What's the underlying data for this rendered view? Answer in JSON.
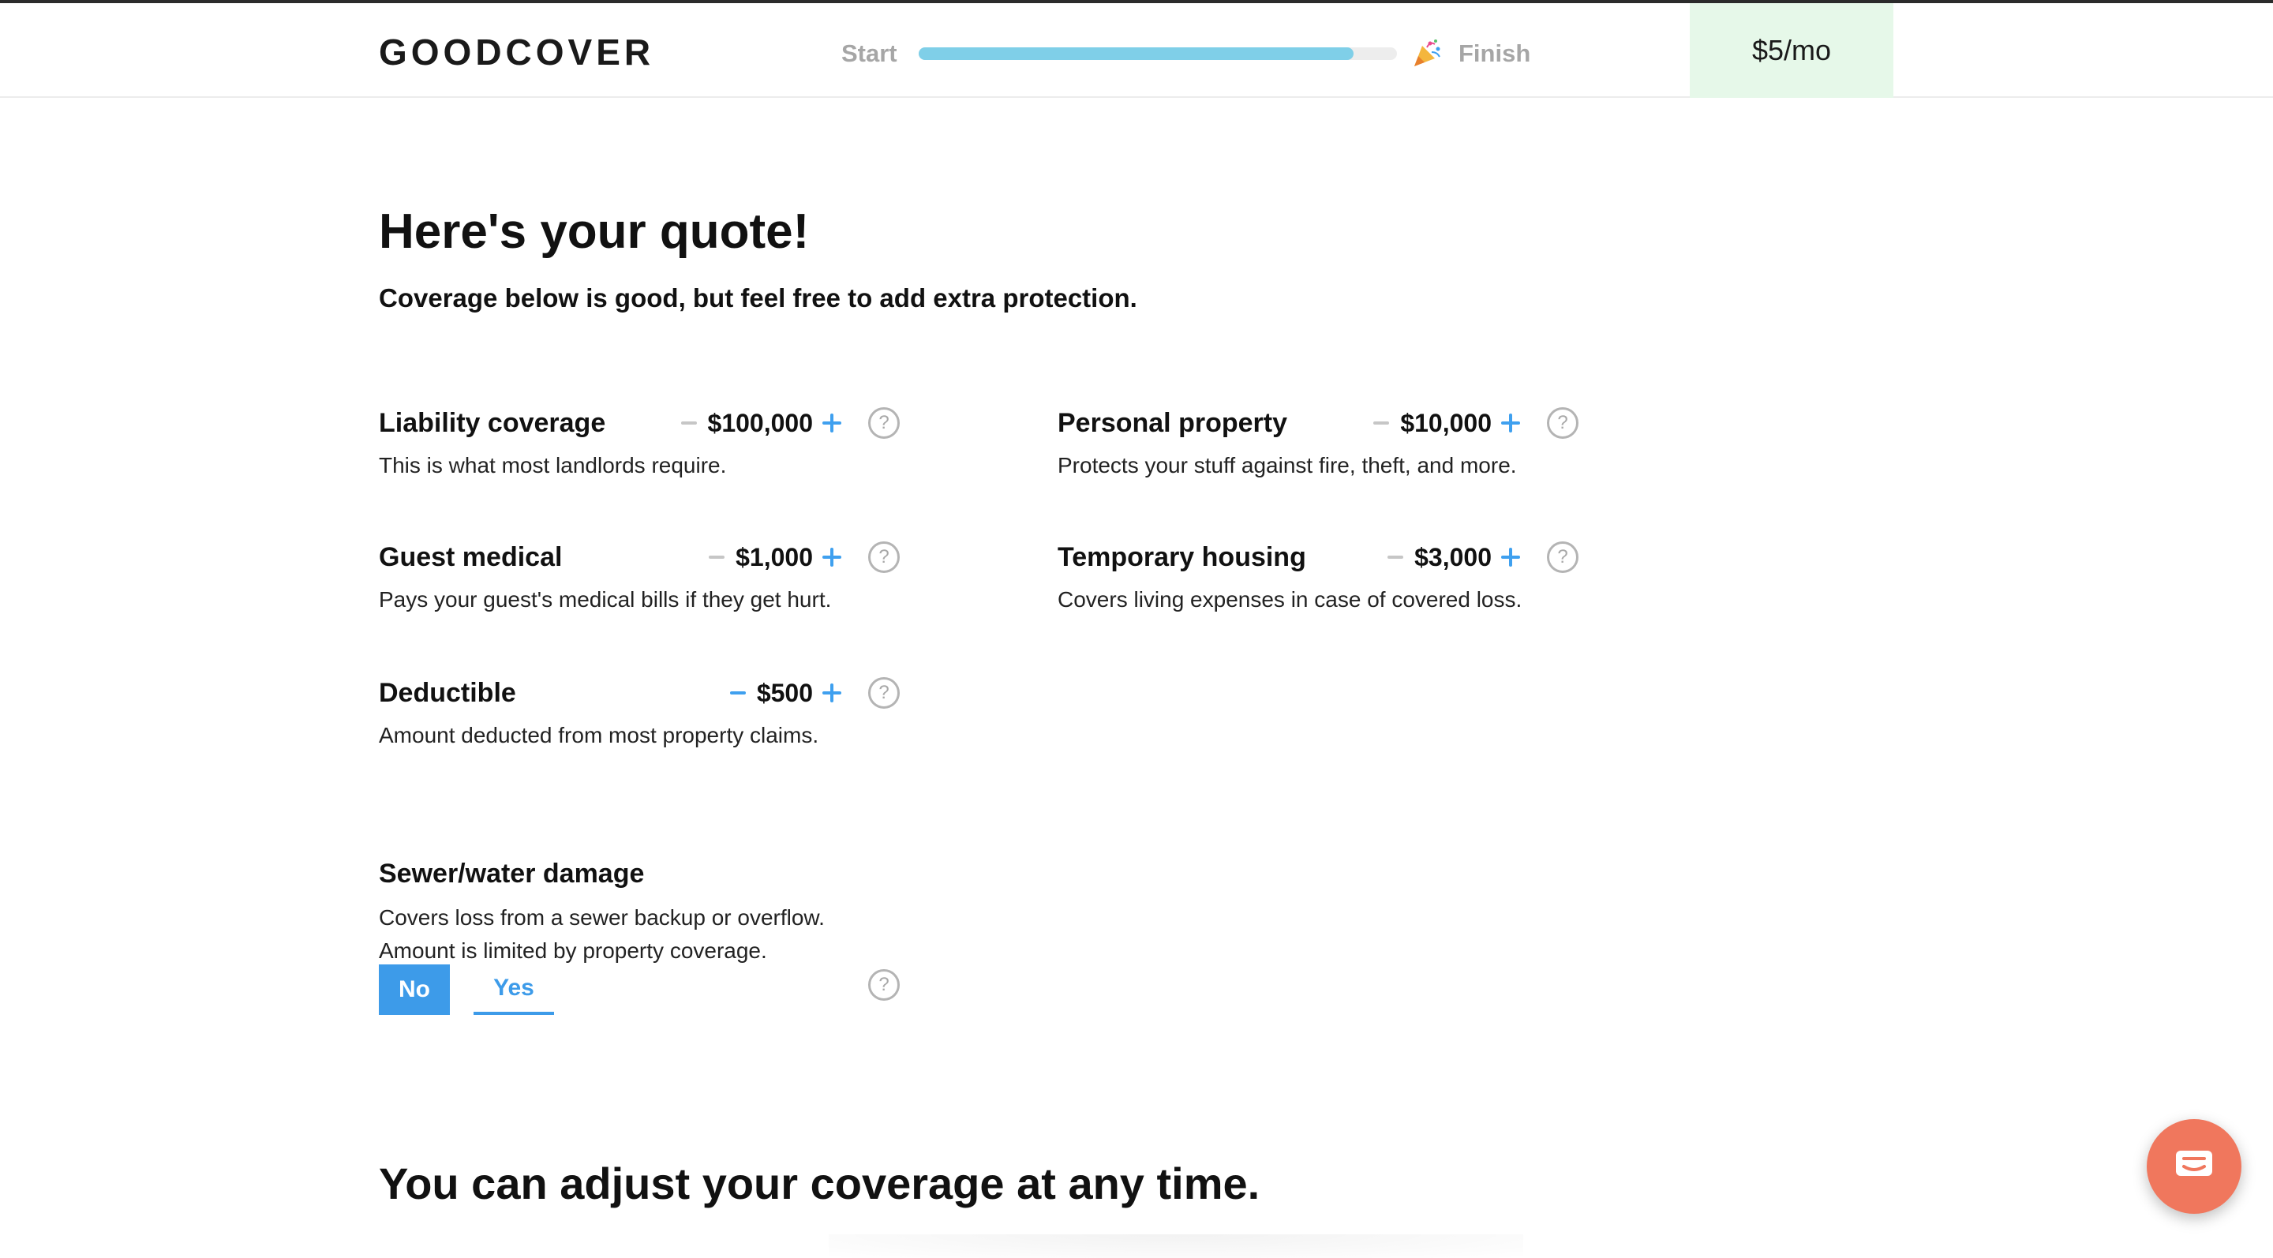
{
  "header": {
    "logo": "GOODCOVER",
    "progress": {
      "start_label": "Start",
      "finish_label": "Finish",
      "fill_fraction": 0.91
    },
    "price": "$5/mo"
  },
  "main": {
    "title": "Here's your quote!",
    "subtitle": "Coverage below is good, but feel free to add extra protection.",
    "coverages": [
      {
        "label": "Liability coverage",
        "value": "$100,000",
        "description": "This is what most landlords require.",
        "minus_active": false
      },
      {
        "label": "Personal property",
        "value": "$10,000",
        "description": "Protects your stuff against fire, theft, and more.",
        "minus_active": false
      },
      {
        "label": "Guest medical",
        "value": "$1,000",
        "description": "Pays your guest's medical bills if they get hurt.",
        "minus_active": false
      },
      {
        "label": "Temporary housing",
        "value": "$3,000",
        "description": "Covers living expenses in case of covered loss.",
        "minus_active": false
      },
      {
        "label": "Deductible",
        "value": "$500",
        "description": "Amount deducted from most property claims.",
        "minus_active": true
      }
    ],
    "sewer": {
      "label": "Sewer/water damage",
      "description_line1": "Covers loss from a sewer backup or overflow.",
      "description_line2": "Amount is limited by property coverage.",
      "no_label": "No",
      "yes_label": "Yes",
      "selected": "No"
    },
    "adjust_title": "You can adjust your coverage at any time.",
    "help_glyph": "?"
  },
  "colors": {
    "accent_blue": "#3d9be9",
    "progress_fill": "#7fcfe8",
    "price_bg": "#e6f8e9",
    "chat_button": "#f0775d"
  },
  "icons": {
    "progress_finish": "party-popper-icon",
    "help": "question-circle-icon",
    "chat": "chat-bubble-icon"
  }
}
